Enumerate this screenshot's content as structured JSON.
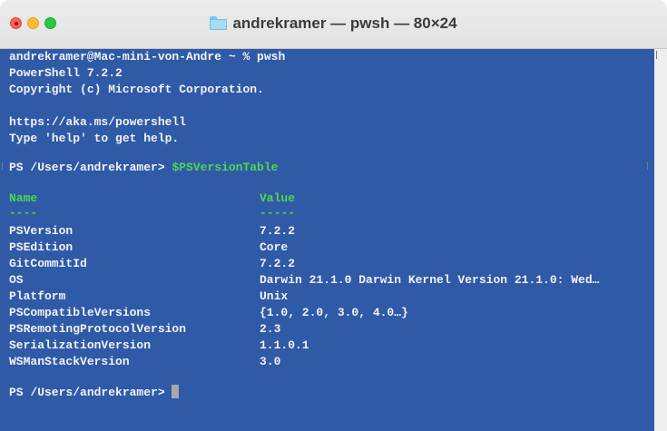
{
  "window": {
    "title": "andrekramer — pwsh — 80×24"
  },
  "terminal": {
    "intro": [
      "andrekramer@Mac-mini-von-Andre ~ % pwsh",
      "PowerShell 7.2.2",
      "Copyright (c) Microsoft Corporation.",
      "",
      "https://aka.ms/powershell",
      "Type 'help' to get help."
    ],
    "prompt1": "PS /Users/andrekramer> ",
    "command1": "$PSVersionTable",
    "table": {
      "header_name": "Name",
      "header_value": "Value",
      "underline_name": "----",
      "underline_value": "-----",
      "rows": [
        {
          "name": "PSVersion",
          "value": "7.2.2"
        },
        {
          "name": "PSEdition",
          "value": "Core"
        },
        {
          "name": "GitCommitId",
          "value": "7.2.2"
        },
        {
          "name": "OS",
          "value": "Darwin 21.1.0 Darwin Kernel Version 21.1.0: Wed…"
        },
        {
          "name": "Platform",
          "value": "Unix"
        },
        {
          "name": "PSCompatibleVersions",
          "value": "{1.0, 2.0, 3.0, 4.0…}"
        },
        {
          "name": "PSRemotingProtocolVersion",
          "value": "2.3"
        },
        {
          "name": "SerializationVersion",
          "value": "1.1.0.1"
        },
        {
          "name": "WSManStackVersion",
          "value": "3.0"
        }
      ]
    },
    "prompt2": "PS /Users/andrekramer> "
  },
  "colors": {
    "background": "#2f5aa8",
    "text": "#f2f2f2",
    "accent_green": "#4fd64f"
  },
  "icons": {
    "title_icon": "folder-icon"
  }
}
